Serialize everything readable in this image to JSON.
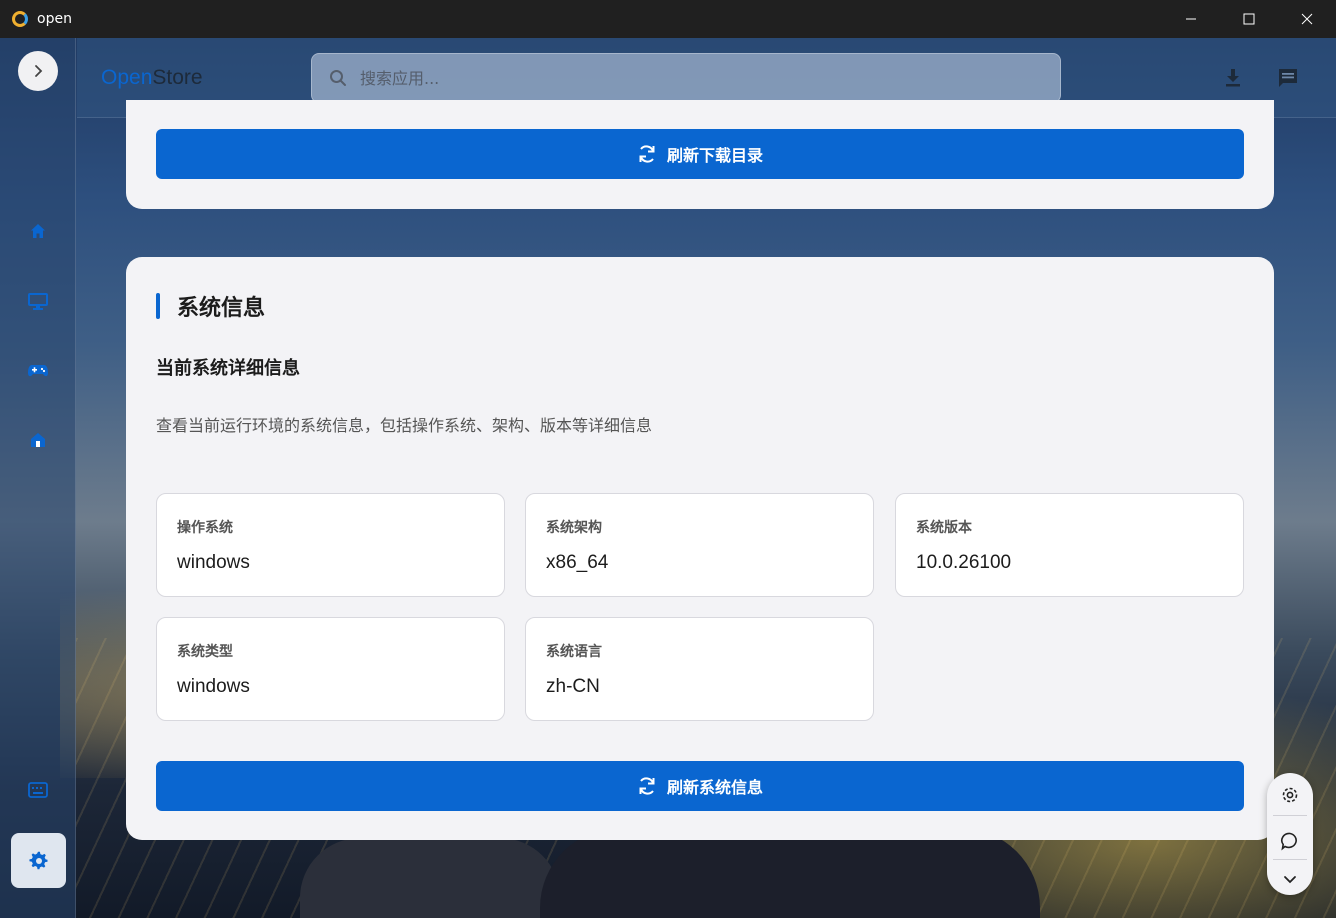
{
  "window": {
    "title": "open",
    "minimize_label": "—",
    "maximize_label": "☐",
    "close_label": "✕"
  },
  "header": {
    "brand_part1": "Open",
    "brand_part2": "Store",
    "search_placeholder": "搜索应用...",
    "icons": [
      "download-icon",
      "message-icon"
    ]
  },
  "sidebar": {
    "items": [
      {
        "icon": "chevron-right-icon"
      },
      {
        "icon": "home-icon"
      },
      {
        "icon": "monitor-icon"
      },
      {
        "icon": "gamepad-icon"
      },
      {
        "icon": "store-icon"
      },
      {
        "icon": "keyboard-icon"
      },
      {
        "icon": "gear-icon"
      }
    ]
  },
  "top_card": {
    "refresh_label": "刷新下载目录"
  },
  "system_info": {
    "title": "系统信息",
    "subtitle": "当前系统详细信息",
    "description": "查看当前运行环境的系统信息，包括操作系统、架构、版本等详细信息",
    "items": [
      {
        "label": "操作系统",
        "value": "windows"
      },
      {
        "label": "系统架构",
        "value": "x86_64"
      },
      {
        "label": "系统版本",
        "value": "10.0.26100"
      },
      {
        "label": "系统类型",
        "value": "windows"
      },
      {
        "label": "系统语言",
        "value": "zh-CN"
      }
    ],
    "refresh_label": "刷新系统信息"
  },
  "floating": {
    "icons": [
      "gear-icon",
      "chat-icon",
      "chevron-down-icon"
    ]
  },
  "colors": {
    "accent": "#0a66d0",
    "card_bg": "#f3f3f6"
  }
}
